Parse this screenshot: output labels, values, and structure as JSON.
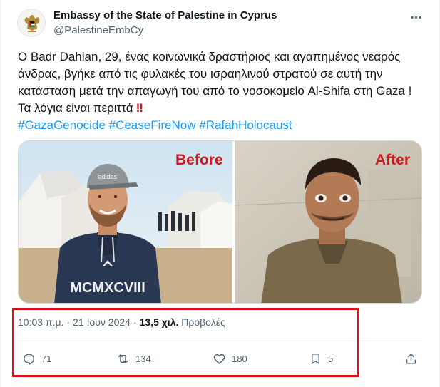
{
  "author": {
    "name": "Embassy of the State of Palestine in Cyprus",
    "handle": "@PalestineEmbCy",
    "avatar_icon": "palestine-eagle-emblem"
  },
  "tweet": {
    "lines": [
      "Ο Badr Dahlan, 29, ένας κοινωνικά δραστήριος και αγαπημένος νεαρός",
      "άνδρας, βγήκε από τις φυλακές του ισραηλινού στρατού σε αυτή την",
      "κατάσταση μετά την απαγωγή του από το νοσοκομείο Al-Shifa στη Gaza !",
      "Τα λόγια είναι περιττά"
    ],
    "emoji": "‼",
    "hashtags": [
      "#GazaGenocide",
      "#CeaseFireNow",
      "#RafahHolocaust"
    ]
  },
  "media": {
    "before_label": "Before",
    "after_label": "After",
    "hoodie_text": "MCMXCVIII",
    "cap_text": "adidas"
  },
  "meta": {
    "time": "10:03 π.μ.",
    "date": "21 Ιουν 2024",
    "views_count": "13,5 χιλ.",
    "views_label": "Προβολές",
    "separator": "·"
  },
  "actions": {
    "replies": "71",
    "reposts": "134",
    "likes": "180",
    "bookmarks": "5"
  },
  "colors": {
    "accent": "#1d9bf0",
    "text": "#0f1419",
    "muted": "#536471",
    "highlight": "#e30f17",
    "label_red": "#d0181e"
  }
}
